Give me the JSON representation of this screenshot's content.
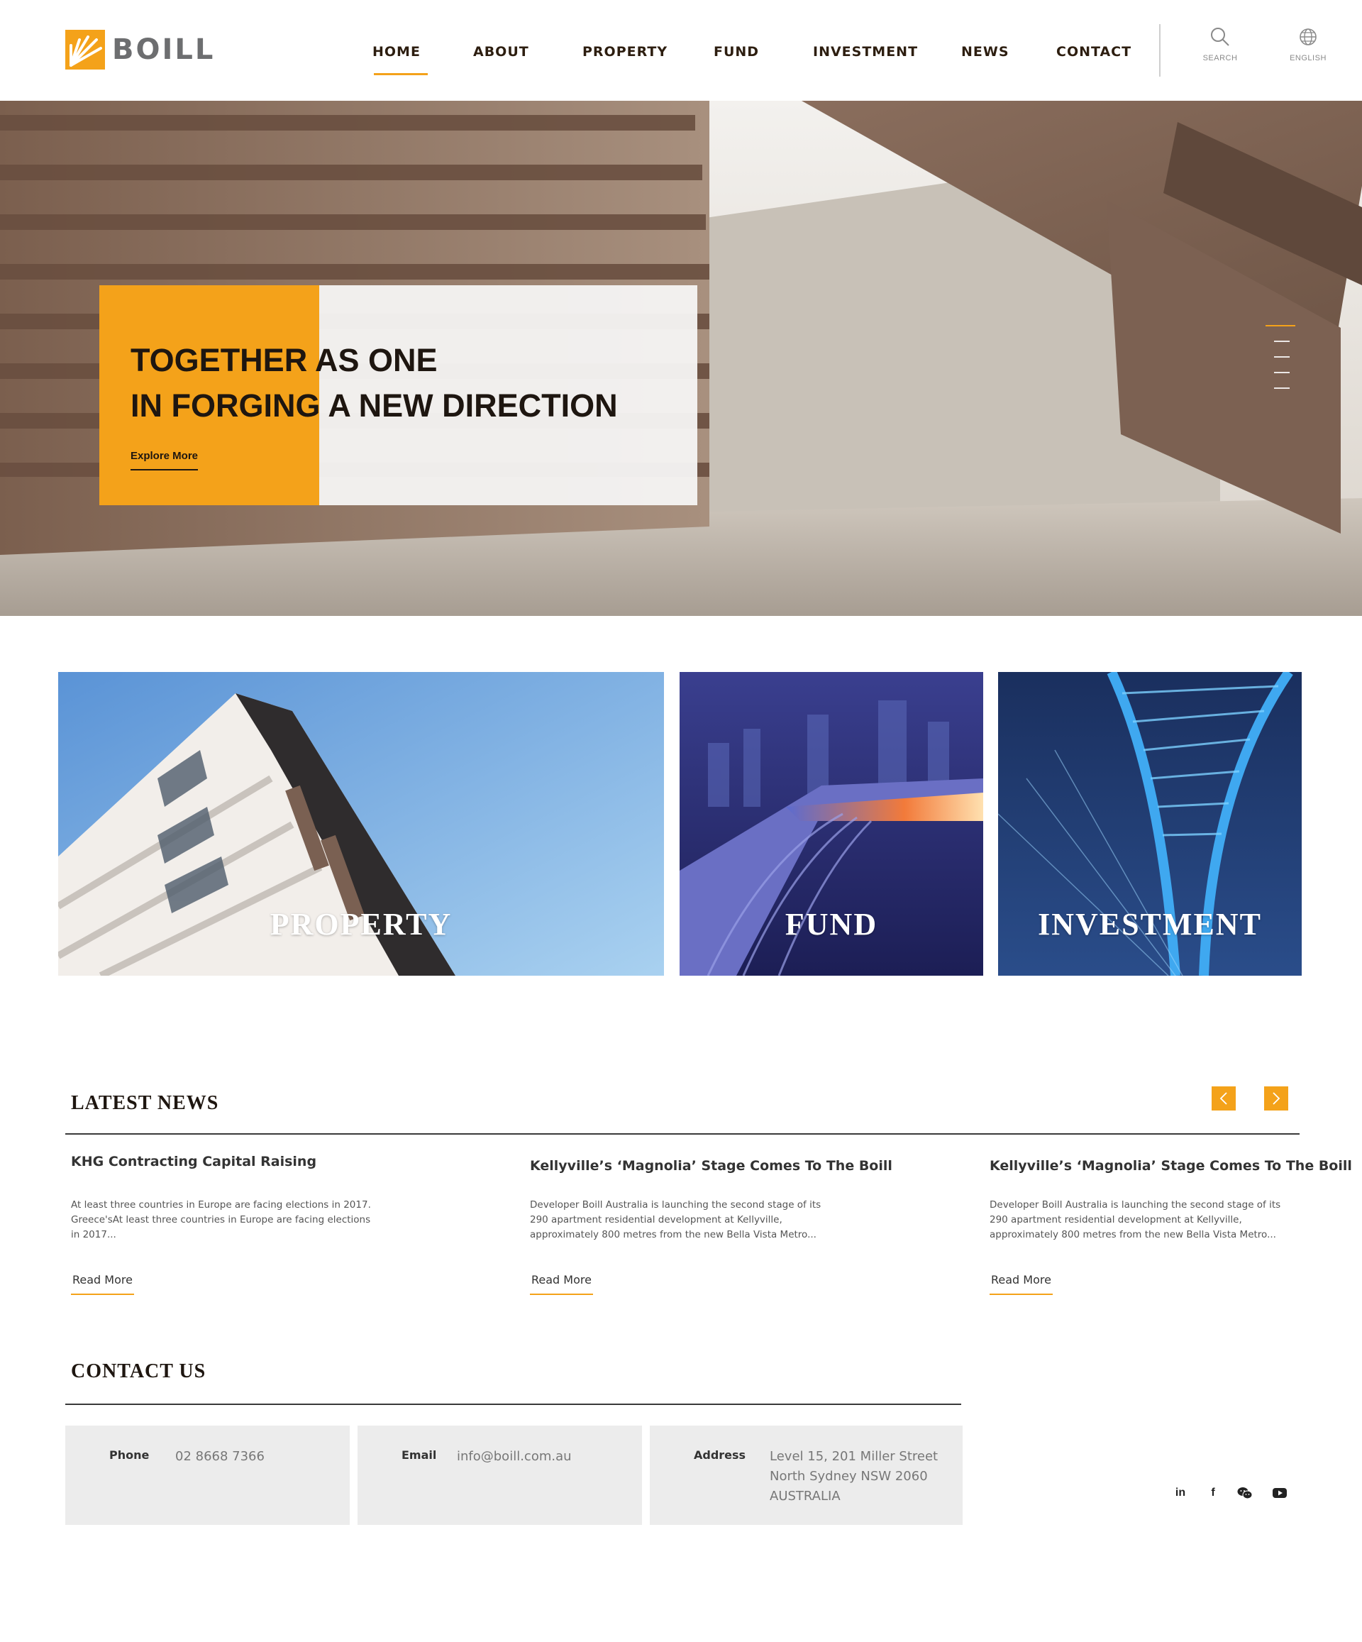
{
  "brand": {
    "name": "BOILL"
  },
  "nav": {
    "items": [
      "HOME",
      "ABOUT",
      "PROPERTY",
      "FUND",
      "INVESTMENT",
      "NEWS",
      "CONTACT"
    ],
    "active": "HOME",
    "search_label": "SEARCH",
    "language_label": "ENGLISH"
  },
  "hero": {
    "title_line1": "TOGETHER AS ONE",
    "title_line2": "IN FORGING A NEW DIRECTION",
    "cta": "Explore More",
    "slide_count": 5,
    "active_slide": 1
  },
  "tiles": [
    {
      "label": "PROPERTY"
    },
    {
      "label": "FUND"
    },
    {
      "label": "INVESTMENT"
    }
  ],
  "news": {
    "heading": "LATEST NEWS",
    "items": [
      {
        "title": "KHG Contracting Capital Raising",
        "excerpt": "At least three countries in Europe are facing elections in 2017. Greece'sAt least three countries in Europe are facing elections in 2017...",
        "link": "Read More"
      },
      {
        "title": "Kellyville’s ‘Magnolia’ Stage Comes To The Boill",
        "excerpt": "Developer Boill Australia is launching the second stage of its 290 apartment residential development at Kellyville, approximately 800 metres from the new Bella Vista Metro...",
        "link": "Read More"
      },
      {
        "title": "Kellyville’s ‘Magnolia’ Stage Comes To The Boill",
        "excerpt": "Developer Boill Australia is launching the second stage of its 290 apartment residential development at Kellyville, approximately 800 metres from the new Bella Vista Metro...",
        "link": "Read More"
      }
    ]
  },
  "contact": {
    "heading": "CONTACT US",
    "phone_label": "Phone",
    "phone": "02 8668 7366",
    "email_label": "Email",
    "email": "info@boill.com.au",
    "address_label": "Address",
    "address_line1": "Level 15, 201 Miller Street",
    "address_line2": "North Sydney NSW 2060",
    "address_line3": "AUSTRALIA"
  },
  "social": {
    "linkedin": "in",
    "facebook": "f"
  },
  "colors": {
    "accent": "#f4a21a",
    "text_dark": "#1e1610",
    "panel": "#ececec"
  }
}
